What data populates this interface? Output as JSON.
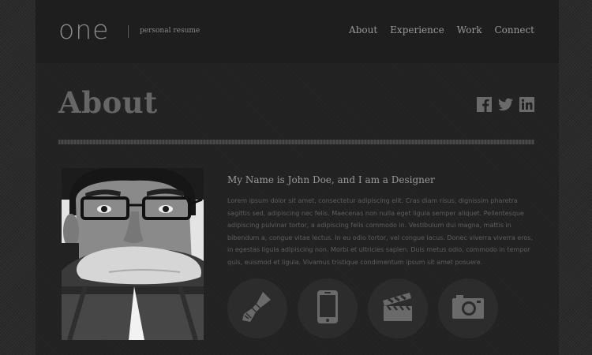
{
  "header": {
    "logo": "one",
    "tagline": "personal resume",
    "nav": [
      "About",
      "Experience",
      "Work",
      "Connect"
    ]
  },
  "main": {
    "title": "About",
    "social": [
      "facebook-icon",
      "twitter-icon",
      "linkedin-icon"
    ],
    "bio_heading": "My Name is John Doe, and I am a Designer",
    "bio_text": "Lorem ipsum dolor sit amet, consectetur adipiscing elit. Cras diam risus, dignissim pharetra sagittis sed, adipiscing nec felis. Maecenas non nulla eget ligula semper aliquet. Pellentesque adipiscing pulvinar tortor, a adipiscing felis commodo in. Vestibulum dui magna, mattis in bibendum a, congue vitae lectus. In eu odio tortor, vel congue lacus. Donec viverra viverra eros, in egestas ligula adipiscing non. Morbi et ultricies sapien. Duis metus odio, commodo in tempor quis, euismod et ligula. Vivamus tristique condimentum ipsum sit amet posuere.",
    "skills": [
      "paintbrush-icon",
      "mobile-phone-icon",
      "clapperboard-icon",
      "camera-icon"
    ]
  },
  "colors": {
    "background": "#2b2b2b",
    "page": "#222222",
    "header": "#1e1e1e",
    "text": "#9a9a9a"
  }
}
